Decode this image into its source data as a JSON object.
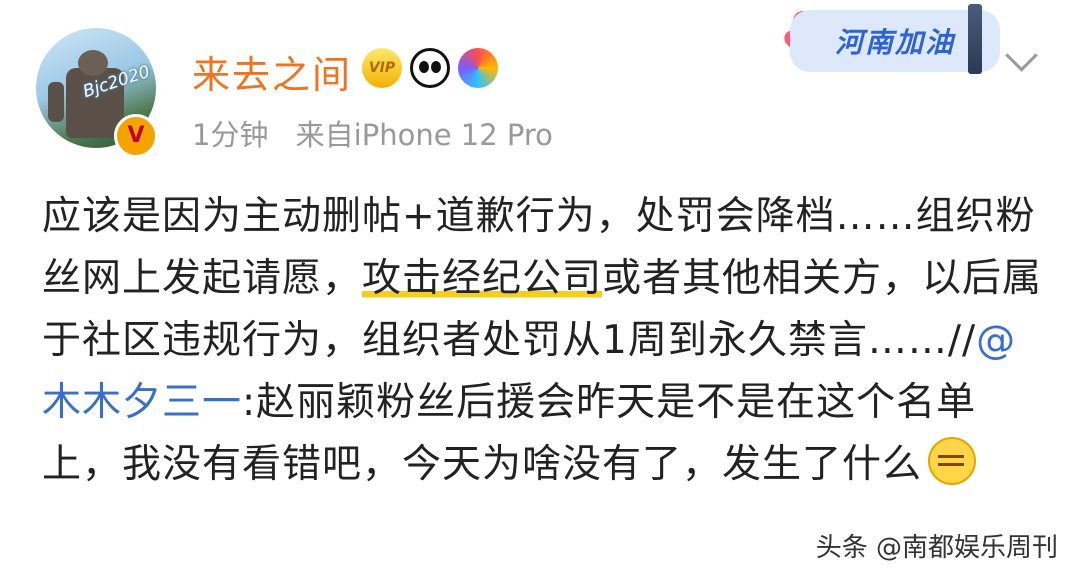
{
  "post": {
    "username": "来去之间",
    "badges": [
      "vip-badge-icon",
      "panda-badge-icon",
      "hot-air-balloon-badge-icon"
    ],
    "vip_label": "VIP",
    "avatar_watermark": "Bjc2020",
    "time": "1分钟",
    "source": "来自iPhone 12 Pro",
    "sticker": "河南加油",
    "verified_label": "V",
    "text_part1": "应该是因为主动删帖+道歉行为，处罚会降档……组织粉丝网上发起请愿，",
    "text_highlight": "攻击经纪公司",
    "text_part2": "或者其他相关方，以后属于社区违规行为，组织者处罚从1周到永久禁言……//",
    "mention": "@木木夕三一",
    "text_part3": ":赵丽颖粉丝后援会昨天是不是在这个名单上，我没有看错吧，今天为啥没有了，发生了什么"
  },
  "watermark": "头条 @南都娱乐周刊",
  "colors": {
    "username": "#f0731f",
    "mention": "#3a6fc9",
    "highlight": "#f6cf1c"
  }
}
